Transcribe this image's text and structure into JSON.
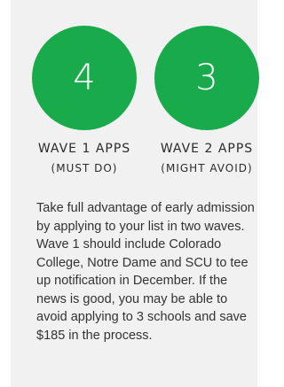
{
  "waves": [
    {
      "count": "4",
      "title": "WAVE 1 APPS",
      "subtitle": "(MUST DO)"
    },
    {
      "count": "3",
      "title": "WAVE 2 APPS",
      "subtitle": "(MIGHT AVOID)"
    }
  ],
  "description": "Take full advantage of early admission by applying to your list in two waves. Wave 1 should include Colorado College, Notre Dame and SCU to tee up notification in December. If the news is good, you may be able to avoid applying to 3 schools and save $185 in the process.",
  "colors": {
    "accent": "#19aa4c",
    "panel_background": "#f1f1f1"
  }
}
